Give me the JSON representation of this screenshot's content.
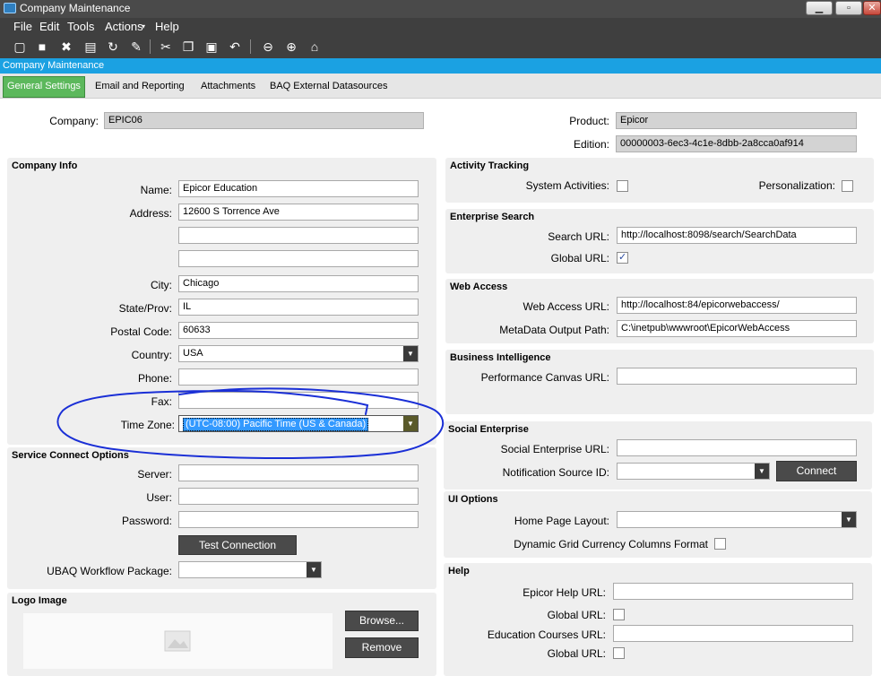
{
  "window": {
    "title": "Company Maintenance"
  },
  "menu": {
    "items": [
      "File",
      "Edit",
      "Tools",
      "Actions",
      "Help"
    ]
  },
  "form_header": "Company Maintenance",
  "tabs": [
    "General Settings",
    "Email and Reporting",
    "Attachments",
    "BAQ External Datasources"
  ],
  "header_fields": {
    "company_label": "Company:",
    "company_value": "EPIC06",
    "product_label": "Product:",
    "product_value": "Epicor",
    "edition_label": "Edition:",
    "edition_value": "00000003-6ec3-4c1e-8dbb-2a8cca0af914"
  },
  "company_info": {
    "title": "Company Info",
    "name_label": "Name:",
    "name_value": "Epicor Education",
    "address_label": "Address:",
    "address1": "12600 S Torrence Ave",
    "address2": "",
    "address3": "",
    "city_label": "City:",
    "city_value": "Chicago",
    "state_label": "State/Prov:",
    "state_value": "IL",
    "postal_label": "Postal Code:",
    "postal_value": "60633",
    "country_label": "Country:",
    "country_value": "USA",
    "phone_label": "Phone:",
    "phone_value": "",
    "fax_label": "Fax:",
    "fax_value": "",
    "timezone_label": "Time Zone:",
    "timezone_value": "(UTC-08:00) Pacific Time (US & Canada)"
  },
  "service_connect": {
    "title": "Service Connect Options",
    "server_label": "Server:",
    "user_label": "User:",
    "password_label": "Password:",
    "test_button": "Test Connection",
    "ubaq_label": "UBAQ Workflow Package:"
  },
  "logo": {
    "title": "Logo Image",
    "browse_button": "Browse...",
    "remove_button": "Remove"
  },
  "activity": {
    "title": "Activity Tracking",
    "system_label": "System Activities:",
    "system_checked": false,
    "personalization_label": "Personalization:",
    "personalization_checked": false
  },
  "enterprise_search": {
    "title": "Enterprise Search",
    "url_label": "Search URL:",
    "url_value": "http://localhost:8098/search/SearchData",
    "global_label": "Global URL:",
    "global_checked": true
  },
  "web_access": {
    "title": "Web Access",
    "url_label": "Web Access URL:",
    "url_value": "http://localhost:84/epicorwebaccess/",
    "meta_label": "MetaData Output Path:",
    "meta_value": "C:\\inetpub\\wwwroot\\EpicorWebAccess"
  },
  "bi": {
    "title": "Business Intelligence",
    "canvas_label": "Performance Canvas URL:"
  },
  "social": {
    "title": "Social Enterprise",
    "url_label": "Social Enterprise URL:",
    "notif_label": "Notification Source ID:",
    "connect_button": "Connect"
  },
  "ui_options": {
    "title": "UI Options",
    "layout_label": "Home Page Layout:",
    "dyn_label": "Dynamic Grid Currency Columns Format"
  },
  "help": {
    "title": "Help",
    "help_url_label": "Epicor Help URL:",
    "global1_label": "Global URL:",
    "edu_label": "Education Courses URL:",
    "global2_label": "Global URL:"
  },
  "colors": {
    "accent": "#1ba1e2",
    "active_tab": "#5cb85c",
    "toolbar": "#3f3f3f",
    "annotation": "#1a2fd6"
  }
}
